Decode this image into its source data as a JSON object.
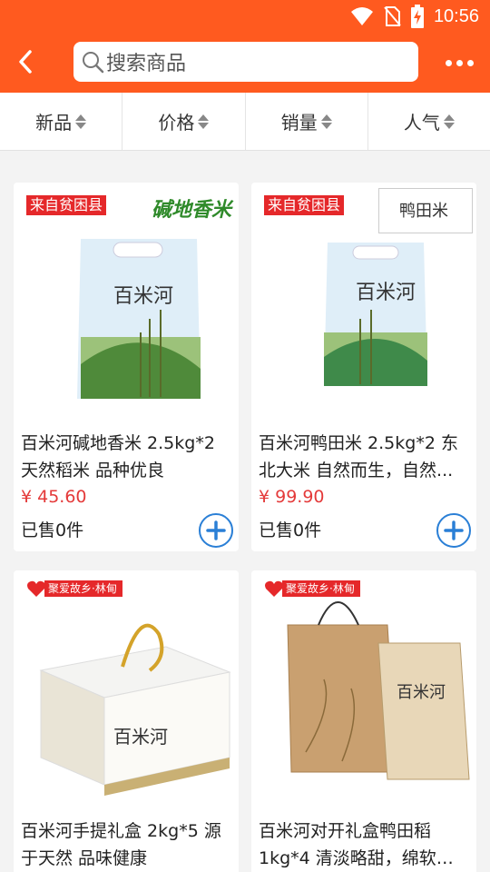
{
  "status_bar": {
    "time": "10:56"
  },
  "header": {
    "search_placeholder": "搜索商品"
  },
  "sort_tabs": [
    "新品",
    "价格",
    "销量",
    "人气"
  ],
  "products": [
    {
      "badge": "来自贫困县",
      "brand_text": "碱地香米",
      "title": "百米河碱地香米 2.5kg*2 天然稻米 品种优良",
      "price": "¥ 45.60",
      "sold": "已售0件",
      "package_label": "百米河"
    },
    {
      "badge": "来自贫困县",
      "brand_text": "鸭田米",
      "title": "百米河鸭田米 2.5kg*2 东北大米 自然而生，自然...",
      "price": "¥ 99.90",
      "sold": "已售0件",
      "package_label": "百米河"
    },
    {
      "badge": "聚爱故乡·林甸",
      "title": "百米河手提礼盒 2kg*5 源于天然 品味健康",
      "package_label": "百米河"
    },
    {
      "badge": "聚爱故乡·林甸",
      "title": "百米河对开礼盒鸭田稻 1kg*4 清淡略甜，绵软略...",
      "package_label": "百米河"
    }
  ],
  "colors": {
    "brand": "#ff5a1f",
    "price": "#e43a3a",
    "badge": "#e5282a",
    "add_button": "#2a7fd6"
  }
}
